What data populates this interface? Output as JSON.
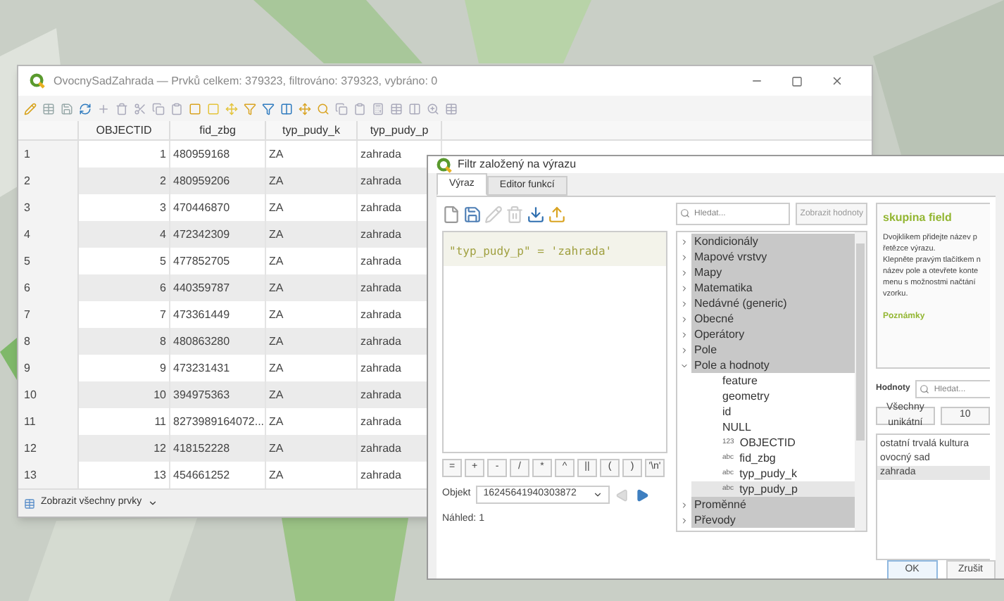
{
  "table_window": {
    "title": "OvocnySadZahrada — Prvků celkem: 379323, filtrováno: 379323, vybráno: 0",
    "columns": [
      "OBJECTID",
      "fid_zbg",
      "typ_pudy_k",
      "typ_pudy_p"
    ],
    "rows": [
      {
        "number": "1",
        "cells": [
          "1",
          "480959168",
          "ZA",
          "zahrada"
        ]
      },
      {
        "number": "2",
        "cells": [
          "2",
          "480959206",
          "ZA",
          "zahrada"
        ]
      },
      {
        "number": "3",
        "cells": [
          "3",
          "470446870",
          "ZA",
          "zahrada"
        ]
      },
      {
        "number": "4",
        "cells": [
          "4",
          "472342309",
          "ZA",
          "zahrada"
        ]
      },
      {
        "number": "5",
        "cells": [
          "5",
          "477852705",
          "ZA",
          "zahrada"
        ]
      },
      {
        "number": "6",
        "cells": [
          "6",
          "440359787",
          "ZA",
          "zahrada"
        ]
      },
      {
        "number": "7",
        "cells": [
          "7",
          "473361449",
          "ZA",
          "zahrada"
        ]
      },
      {
        "number": "8",
        "cells": [
          "8",
          "480863280",
          "ZA",
          "zahrada"
        ]
      },
      {
        "number": "9",
        "cells": [
          "9",
          "473231431",
          "ZA",
          "zahrada"
        ]
      },
      {
        "number": "10",
        "cells": [
          "10",
          "394975363",
          "ZA",
          "zahrada"
        ]
      },
      {
        "number": "11",
        "cells": [
          "11",
          "8273989164072...",
          "ZA",
          "zahrada"
        ]
      },
      {
        "number": "12",
        "cells": [
          "12",
          "418152228",
          "ZA",
          "zahrada"
        ]
      },
      {
        "number": "13",
        "cells": [
          "13",
          "454661252",
          "ZA",
          "zahrada"
        ]
      }
    ],
    "footer_button": "Zobrazit všechny prvky"
  },
  "dialog": {
    "title": "Filtr založený na výrazu",
    "tabs": [
      {
        "label": "Výraz",
        "selected": true
      },
      {
        "label": "Editor funkcí",
        "selected": false
      }
    ],
    "expression": "\"typ_pudy_p\" = 'zahrada'",
    "operators": [
      "=",
      "+",
      "-",
      "/",
      "*",
      "^",
      "||",
      "(",
      ")",
      "'\\n'"
    ],
    "object_label": "Objekt",
    "object_value": "16245641940303872",
    "preview": "Náhled: 1",
    "search": {
      "placeholder": "Hledat..."
    },
    "show_values_button": "Zobrazit hodnoty",
    "tree": [
      {
        "label": "Kondicionály",
        "kind": "group",
        "expanded": false,
        "selected": false
      },
      {
        "label": "Mapové vrstvy",
        "kind": "group",
        "expanded": false,
        "selected": false
      },
      {
        "label": "Mapy",
        "kind": "group",
        "expanded": false,
        "selected": false
      },
      {
        "label": "Matematika",
        "kind": "group",
        "expanded": false,
        "selected": false
      },
      {
        "label": "Nedávné (generic)",
        "kind": "group",
        "expanded": false,
        "selected": false
      },
      {
        "label": "Obecné",
        "kind": "group",
        "expanded": false,
        "selected": false
      },
      {
        "label": "Operátory",
        "kind": "group",
        "expanded": false,
        "selected": false
      },
      {
        "label": "Pole",
        "kind": "group",
        "expanded": false,
        "selected": false
      },
      {
        "label": "Pole a hodnoty",
        "kind": "group",
        "expanded": true,
        "selected": false,
        "children": [
          {
            "label": "feature",
            "kind": "item",
            "selected": false
          },
          {
            "label": "geometry",
            "kind": "item",
            "selected": false
          },
          {
            "label": "id",
            "kind": "item",
            "selected": false
          },
          {
            "label": "NULL",
            "kind": "item",
            "selected": false
          },
          {
            "label": "OBJECTID",
            "kind": "field",
            "type": "123",
            "selected": false
          },
          {
            "label": "fid_zbg",
            "kind": "field",
            "type": "abc",
            "selected": false
          },
          {
            "label": "typ_pudy_k",
            "kind": "field",
            "type": "abc",
            "selected": false
          },
          {
            "label": "typ_pudy_p",
            "kind": "field",
            "type": "abc",
            "selected": true
          }
        ]
      },
      {
        "label": "Proměnné",
        "kind": "group",
        "expanded": false,
        "selected": false
      },
      {
        "label": "Převody",
        "kind": "group",
        "expanded": false,
        "selected": false
      }
    ],
    "help": {
      "heading": "skupina field",
      "lines": [
        "Dvojklikem přidejte název p",
        "řetězce výrazu.",
        "Klepněte pravým tlačítkem n",
        "název pole a otevřete konte",
        "menu s možnostmi načtání",
        "vzorku."
      ],
      "notes_heading": "Poznámky"
    },
    "values_label": "Hodnoty",
    "values_search": {
      "placeholder": "Hledat..."
    },
    "value_buttons": [
      "Všechny unikátní",
      "10"
    ],
    "values": [
      {
        "label": "ostatní trvalá kultura",
        "selected": false
      },
      {
        "label": "ovocný sad",
        "selected": false
      },
      {
        "label": "zahrada",
        "selected": true
      }
    ],
    "buttons": [
      "OK",
      "Zrušit"
    ]
  }
}
